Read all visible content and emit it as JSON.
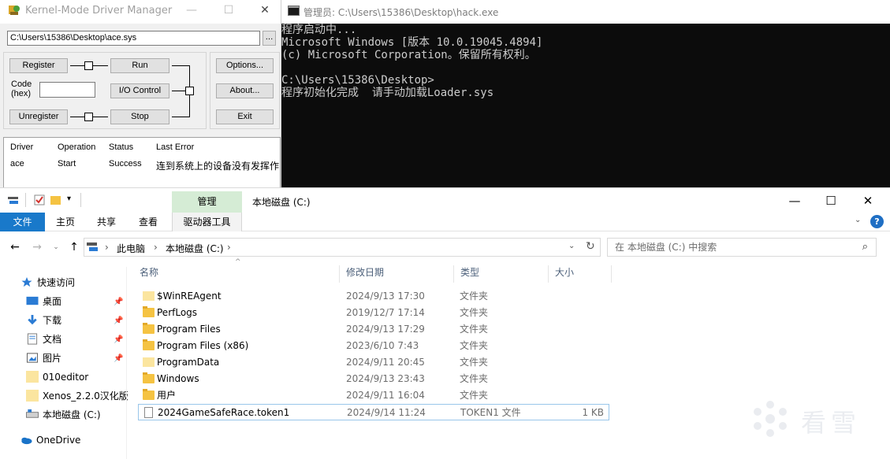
{
  "kdm": {
    "title": "Kernel-Mode Driver Manager",
    "minimize_glyph": "—",
    "maximize_glyph": "☐",
    "close_glyph": "✕",
    "driver_path": "C:\\Users\\15386\\Desktop\\ace.sys",
    "browse_label": "...",
    "register_label": "Register",
    "run_label": "Run",
    "code_label_line1": "Code",
    "code_label_line2": "(hex)",
    "io_control_label": "I/O Control",
    "unregister_label": "Unregister",
    "stop_label": "Stop",
    "options_label": "Options...",
    "about_label": "About...",
    "exit_label": "Exit",
    "list_headers": [
      "Driver",
      "Operation",
      "Status",
      "Last Error"
    ],
    "list_rows": [
      {
        "driver": "ace",
        "operation": "Start",
        "status": "Success",
        "last_error": "连到系统上的设备没有发挥作"
      }
    ]
  },
  "console": {
    "title": "管理员: C:\\Users\\15386\\Desktop\\hack.exe",
    "lines": [
      "程序启动中...",
      "Microsoft Windows [版本 10.0.19045.4894]",
      "(c) Microsoft Corporation。保留所有权利。",
      "",
      "C:\\Users\\15386\\Desktop>",
      "程序初始化完成  请手动加载Loader.sys"
    ]
  },
  "explorer": {
    "title": "本地磁盘 (C:)",
    "manage_tab": "管理",
    "ribbon_tabs": {
      "file": "文件",
      "home": "主页",
      "share": "共享",
      "view": "查看",
      "driver_tools": "驱动器工具"
    },
    "minimize_glyph": "—",
    "maximize_glyph": "☐",
    "close_glyph": "✕",
    "help_glyph": "?",
    "breadcrumb": [
      "此电脑",
      "本地磁盘 (C:)"
    ],
    "search_placeholder": "在 本地磁盘 (C:) 中搜索",
    "nav_items": [
      {
        "label": "快速访问",
        "icon": "star-icon",
        "pinned": false
      },
      {
        "label": "桌面",
        "icon": "desktop-icon",
        "pinned": true
      },
      {
        "label": "下载",
        "icon": "download-icon",
        "pinned": true
      },
      {
        "label": "文档",
        "icon": "documents-icon",
        "pinned": true
      },
      {
        "label": "图片",
        "icon": "pictures-icon",
        "pinned": true
      },
      {
        "label": "010editor",
        "icon": "folder-icon",
        "pinned": false
      },
      {
        "label": "Xenos_2.2.0汉化版",
        "icon": "folder-icon",
        "pinned": false
      },
      {
        "label": "本地磁盘 (C:)",
        "icon": "drive-icon",
        "pinned": false
      },
      {
        "label": "OneDrive",
        "icon": "onedrive-icon",
        "pinned": false
      }
    ],
    "columns": [
      "名称",
      "修改日期",
      "类型",
      "大小"
    ],
    "files": [
      {
        "name": "$WinREAgent",
        "date": "2024/9/13 17:30",
        "type": "文件夹",
        "size": "",
        "kind": "folder-pale"
      },
      {
        "name": "PerfLogs",
        "date": "2019/12/7 17:14",
        "type": "文件夹",
        "size": "",
        "kind": "folder"
      },
      {
        "name": "Program Files",
        "date": "2024/9/13 17:29",
        "type": "文件夹",
        "size": "",
        "kind": "folder"
      },
      {
        "name": "Program Files (x86)",
        "date": "2023/6/10 7:43",
        "type": "文件夹",
        "size": "",
        "kind": "folder"
      },
      {
        "name": "ProgramData",
        "date": "2024/9/11 20:45",
        "type": "文件夹",
        "size": "",
        "kind": "folder-pale"
      },
      {
        "name": "Windows",
        "date": "2024/9/13 23:43",
        "type": "文件夹",
        "size": "",
        "kind": "folder"
      },
      {
        "name": "用户",
        "date": "2024/9/11 16:04",
        "type": "文件夹",
        "size": "",
        "kind": "folder"
      },
      {
        "name": "2024GameSafeRace.token1",
        "date": "2024/9/14 11:24",
        "type": "TOKEN1 文件",
        "size": "1 KB",
        "kind": "doc"
      }
    ]
  },
  "watermark_text": "看雪",
  "colors": {
    "ribbon_file_tab": "#1979ca",
    "manage_tab": "#d5ecd5",
    "console_bg": "#0c0c0c",
    "console_text": "#cccccc",
    "folder": "#f5c342",
    "selection_border": "#99c6ea"
  }
}
